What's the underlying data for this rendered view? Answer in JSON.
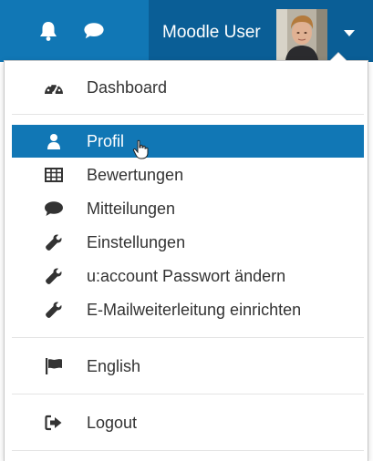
{
  "navbar": {
    "bg_color": "#1177b5",
    "user_bg_color": "#0a5e96",
    "notifications_icon": "bell-icon",
    "messages_icon": "speech-bubble-icon",
    "user_name": "Moodle User",
    "dropdown_icon": "caret-down-icon"
  },
  "menu": {
    "highlight_color": "#1177b5",
    "groups": [
      [
        {
          "label": "Dashboard",
          "icon": "dashboard-gauge-icon"
        }
      ],
      [
        {
          "label": "Profil",
          "icon": "user-icon",
          "active": true
        },
        {
          "label": "Bewertungen",
          "icon": "table-grid-icon"
        },
        {
          "label": "Mitteilungen",
          "icon": "speech-bubble-icon"
        },
        {
          "label": "Einstellungen",
          "icon": "wrench-icon"
        },
        {
          "label": "u:account Passwort ändern",
          "icon": "wrench-icon"
        },
        {
          "label": "E-Mailweiterleitung einrichten",
          "icon": "wrench-icon"
        }
      ],
      [
        {
          "label": "English",
          "icon": "flag-icon"
        }
      ],
      [
        {
          "label": "Logout",
          "icon": "sign-out-icon"
        }
      ]
    ]
  }
}
